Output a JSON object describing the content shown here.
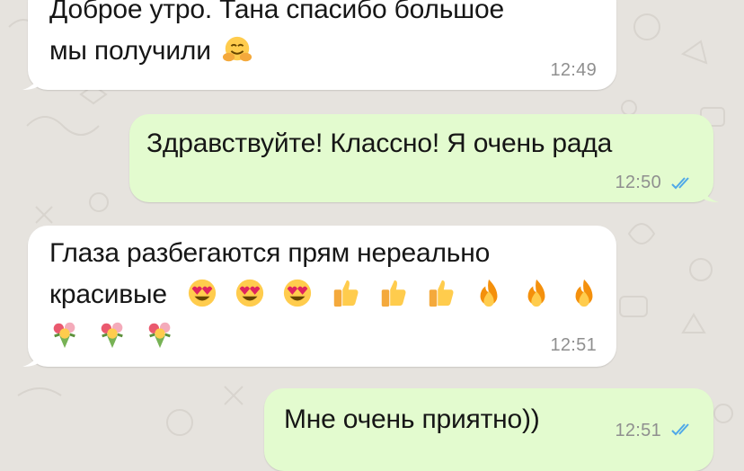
{
  "messages": [
    {
      "direction": "incoming",
      "line1": "Доброе утро. Тана спасибо большое",
      "line2": "мы получили",
      "emojis": [
        "hugging-face-emoji"
      ],
      "time": "12:49"
    },
    {
      "direction": "outgoing",
      "line1": "Здравствуйте! Классно! Я очень рада",
      "time": "12:50",
      "status": "read"
    },
    {
      "direction": "incoming",
      "line1": "Глаза разбегаются прям нереально",
      "line2": "красивые",
      "emojis_line2": [
        "heart-eyes-emoji",
        "heart-eyes-emoji",
        "heart-eyes-emoji",
        "thumbs-up-emoji",
        "thumbs-up-emoji",
        "thumbs-up-emoji",
        "fire-emoji",
        "fire-emoji",
        "fire-emoji"
      ],
      "emojis_line3": [
        "bouquet-emoji",
        "bouquet-emoji",
        "bouquet-emoji"
      ],
      "time": "12:51"
    },
    {
      "direction": "outgoing",
      "line1": "Мне очень приятно))",
      "time": "12:51",
      "status": "read"
    }
  ],
  "colors": {
    "background": "#e6e3de",
    "incoming_bubble": "#ffffff",
    "outgoing_bubble": "#e3fbcf",
    "read_ticks": "#4fa8e8",
    "timestamp": "#8f8f8f"
  }
}
